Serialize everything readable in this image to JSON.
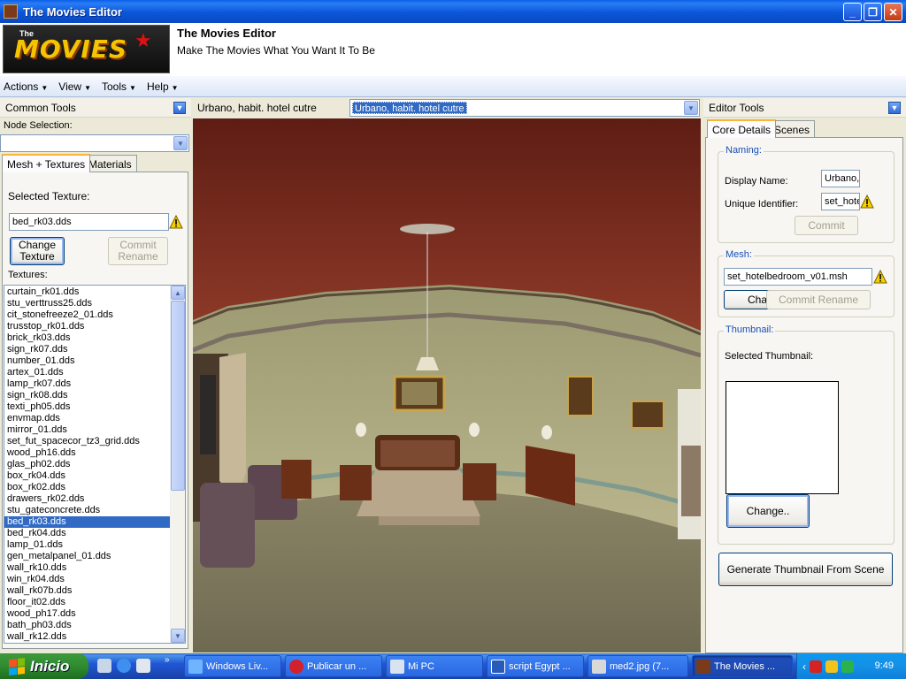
{
  "window": {
    "title": "The Movies Editor"
  },
  "header": {
    "logo_text": "MOVIES",
    "logo_the": "The",
    "title": "The Movies Editor",
    "subtitle": "Make The Movies What You Want It To Be"
  },
  "menu": [
    {
      "label": "Actions"
    },
    {
      "label": "View"
    },
    {
      "label": "Tools"
    },
    {
      "label": "Help"
    }
  ],
  "left": {
    "title": "Common Tools",
    "node_selection_label": "Node Selection:",
    "node_selection_value": "",
    "tabs": [
      "Mesh + Textures",
      "Materials"
    ],
    "selected_texture_label": "Selected Texture:",
    "selected_texture_value": "bed_rk03.dds",
    "change_texture_label": "Change Texture",
    "commit_rename_label": "Commit Rename",
    "textures_label": "Textures:",
    "textures": [
      "curtain_rk01.dds",
      "stu_verttruss25.dds",
      "cit_stonefreeze2_01.dds",
      "trusstop_rk01.dds",
      "brick_rk03.dds",
      "sign_rk07.dds",
      "number_01.dds",
      "artex_01.dds",
      "lamp_rk07.dds",
      "sign_rk08.dds",
      "texti_ph05.dds",
      "envmap.dds",
      "mirror_01.dds",
      "set_fut_spacecor_tz3_grid.dds",
      "wood_ph16.dds",
      "glas_ph02.dds",
      "box_rk04.dds",
      "box_rk02.dds",
      "drawers_rk02.dds",
      "stu_gateconcrete.dds",
      "bed_rk03.dds",
      "bed_rk04.dds",
      "lamp_01.dds",
      "gen_metalpanel_01.dds",
      "wall_rk10.dds",
      "win_rk04.dds",
      "wall_rk07b.dds",
      "floor_it02.dds",
      "wood_ph17.dds",
      "bath_ph03.dds",
      "wall_rk12.dds"
    ],
    "selected_index": 20
  },
  "center": {
    "scene_label": "Urbano, habit. hotel cutre",
    "scene_combo_value": "Urbano, habit. hotel cutre"
  },
  "right": {
    "title": "Editor Tools",
    "tabs": [
      "Core Details",
      "Scenes"
    ],
    "naming_title": "Naming:",
    "display_name_label": "Display Name:",
    "display_name_value": "Urbano,",
    "unique_id_label": "Unique Identifier:",
    "unique_id_value": "set_hote",
    "commit_label": "Commit",
    "mesh_title": "Mesh:",
    "mesh_value": "set_hotelbedroom_v01.msh",
    "mesh_change_label": "Chang",
    "mesh_commit_rename_label": "Commit Rename",
    "thumbnail_title": "Thumbnail:",
    "selected_thumbnail_label": "Selected Thumbnail:",
    "thumb_change_label": "Change..",
    "generate_label": "Generate Thumbnail  From Scene"
  },
  "taskbar": {
    "start_label": "Inicio",
    "buttons": [
      {
        "label": "Windows Liv..."
      },
      {
        "label": "Publicar un ..."
      },
      {
        "label": "Mi PC"
      },
      {
        "label": "script Egypt ..."
      },
      {
        "label": "med2.jpg (7..."
      },
      {
        "label": "The Movies ..."
      }
    ],
    "clock": "9:49"
  },
  "colors": {
    "selection": "#316ac5",
    "title_bar": "#0a5fe6",
    "start": "#2f8b2f",
    "group_title": "#1a50b8"
  }
}
